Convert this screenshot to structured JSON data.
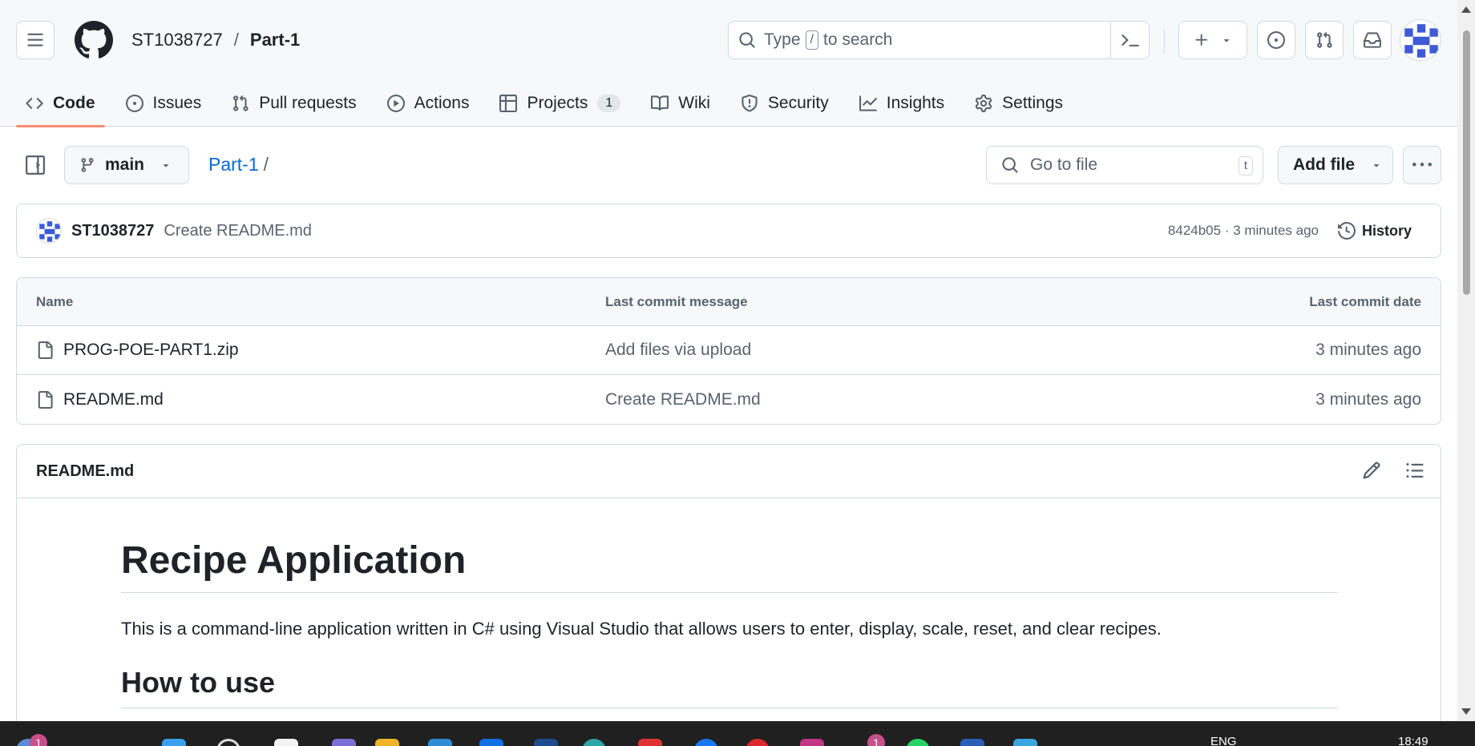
{
  "header": {
    "owner": "ST1038727",
    "separator": "/",
    "repo": "Part-1",
    "search": {
      "prefix": "Type",
      "key": "/",
      "suffix": "to search"
    }
  },
  "tabs": [
    {
      "label": "Code",
      "icon": "code-icon"
    },
    {
      "label": "Issues",
      "icon": "issue-opened-icon"
    },
    {
      "label": "Pull requests",
      "icon": "git-pull-request-icon"
    },
    {
      "label": "Actions",
      "icon": "play-icon"
    },
    {
      "label": "Projects",
      "icon": "table-icon",
      "count": "1"
    },
    {
      "label": "Wiki",
      "icon": "book-icon"
    },
    {
      "label": "Security",
      "icon": "shield-icon"
    },
    {
      "label": "Insights",
      "icon": "graph-icon"
    },
    {
      "label": "Settings",
      "icon": "gear-icon"
    }
  ],
  "toolbar": {
    "branch": "main",
    "path_repo": "Part-1",
    "path_sep": "/",
    "go_to_file": "Go to file",
    "go_to_file_key": "t",
    "add_file": "Add file"
  },
  "commit": {
    "author": "ST1038727",
    "message": "Create README.md",
    "meta": "8424b05 · 3 minutes ago",
    "history": "History"
  },
  "files": {
    "headers": [
      "Name",
      "Last commit message",
      "Last commit date"
    ],
    "rows": [
      {
        "name": "PROG-POE-PART1.zip",
        "message": "Add files via upload",
        "date": "3 minutes ago"
      },
      {
        "name": "README.md",
        "message": "Create README.md",
        "date": "3 minutes ago"
      }
    ]
  },
  "readme": {
    "filename": "README.md",
    "title": "Recipe Application",
    "intro": "This is a command-line application written in C# using Visual Studio that allows users to enter, display, scale, reset, and clear recipes.",
    "h2": "How to use"
  },
  "taskbar": {
    "badge_left": "1",
    "badge_mid": "1",
    "lang": "ENG",
    "time": "18:49"
  },
  "colors": {
    "accent": "#0969da",
    "active_underline": "#fd8c73",
    "border": "#d1d9e0",
    "header_bg": "#f6f8fa"
  }
}
